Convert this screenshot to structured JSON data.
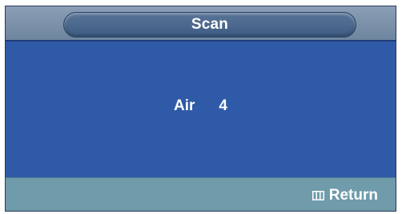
{
  "osd": {
    "title": "Scan",
    "channel": {
      "band": "Air",
      "number": "4"
    },
    "footer": {
      "return_label": "Return",
      "return_icon": "menu-icon"
    },
    "colors": {
      "content_bg": "#2f5aa8",
      "footer_bg": "#6f9bab",
      "title_pill": "#4d6a8f"
    }
  }
}
